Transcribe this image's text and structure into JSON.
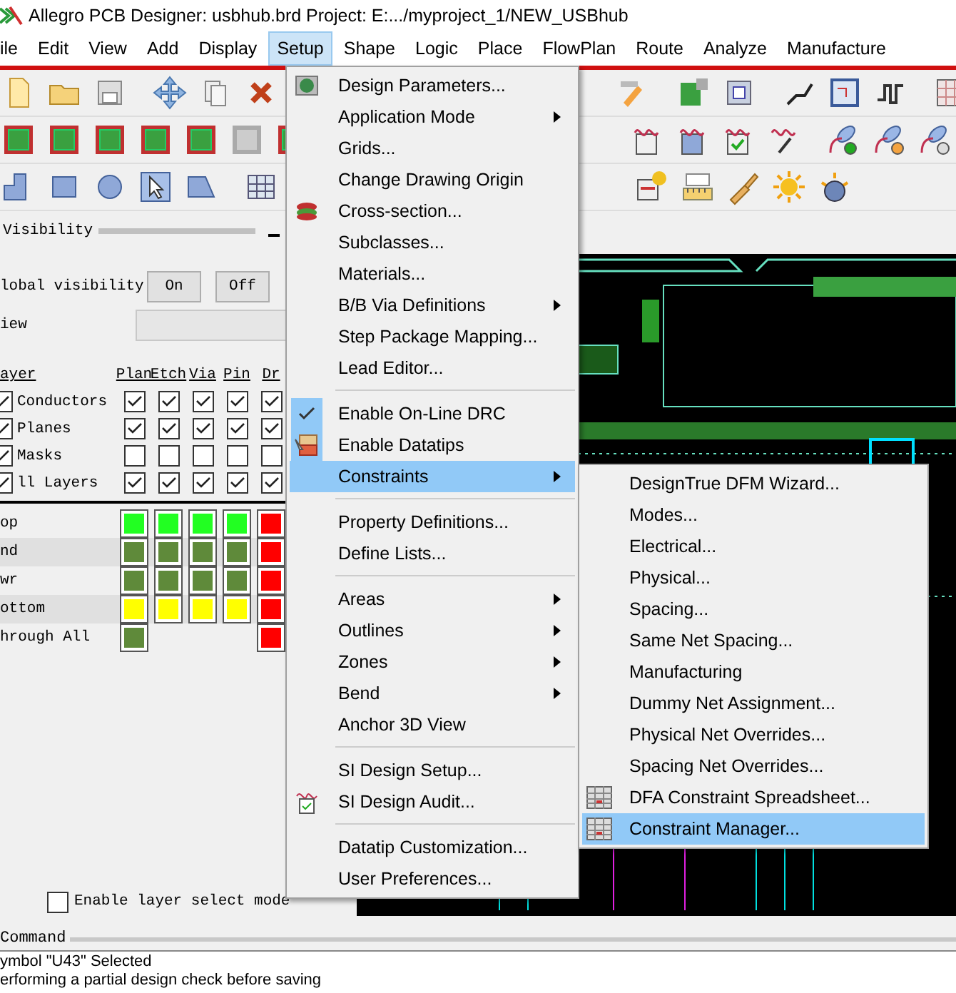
{
  "window": {
    "title": "Allegro PCB Designer: usbhub.brd  Project: E:.../myproject_1/NEW_USBhub"
  },
  "menu_bar": [
    {
      "label": "ile",
      "selected": false
    },
    {
      "label": "Edit",
      "selected": false
    },
    {
      "label": "View",
      "selected": false
    },
    {
      "label": "Add",
      "selected": false
    },
    {
      "label": "Display",
      "selected": false
    },
    {
      "label": "Setup",
      "selected": true
    },
    {
      "label": "Shape",
      "selected": false
    },
    {
      "label": "Logic",
      "selected": false
    },
    {
      "label": "Place",
      "selected": false
    },
    {
      "label": "FlowPlan",
      "selected": false
    },
    {
      "label": "Route",
      "selected": false
    },
    {
      "label": "Analyze",
      "selected": false
    },
    {
      "label": "Manufacture",
      "selected": false
    }
  ],
  "visibility_panel": {
    "title": "Visibility",
    "global_label": "lobal visibility",
    "global_buttons": [
      "On",
      "Off"
    ],
    "view_label": "iew",
    "columns": [
      "ayer",
      "Plan",
      "Etch",
      "Via",
      "Pin",
      "Dr"
    ],
    "class_rows": [
      {
        "name": "Conductors",
        "checked": true,
        "cells": [
          true,
          true,
          true,
          true,
          true
        ]
      },
      {
        "name": "Planes",
        "checked": true,
        "cells": [
          true,
          true,
          true,
          true,
          true
        ]
      },
      {
        "name": "Masks",
        "checked": true,
        "cells": [
          false,
          false,
          false,
          false,
          false
        ]
      },
      {
        "name": "ll Layers",
        "checked": true,
        "cells": [
          true,
          true,
          true,
          true,
          true
        ]
      }
    ],
    "layer_rows": [
      {
        "name": "op",
        "swatches": [
          {
            "color": "#22ff22"
          },
          {
            "color": "#22ff22"
          },
          {
            "color": "#22ff22"
          },
          {
            "color": "#22ff22"
          },
          {
            "color": "#ff0000"
          }
        ]
      },
      {
        "name": "nd",
        "swatches": [
          {
            "color": "#5f8a3a"
          },
          {
            "color": "#5f8a3a"
          },
          {
            "color": "#5f8a3a"
          },
          {
            "color": "#5f8a3a"
          },
          {
            "color": "#ff0000"
          }
        ]
      },
      {
        "name": "wr",
        "swatches": [
          {
            "color": "#5f8a3a"
          },
          {
            "color": "#5f8a3a"
          },
          {
            "color": "#5f8a3a"
          },
          {
            "color": "#5f8a3a"
          },
          {
            "color": "#ff0000"
          }
        ]
      },
      {
        "name": "ottom",
        "swatches": [
          {
            "color": "#ffff00"
          },
          {
            "color": "#ffff00"
          },
          {
            "color": "#ffff00"
          },
          {
            "color": "#ffff00"
          },
          {
            "color": "#ff0000"
          }
        ]
      },
      {
        "name": "hrough All",
        "swatches": [
          {
            "color": "#5f8a3a"
          },
          {
            "kind": "blank"
          },
          {
            "kind": "blank"
          },
          {
            "kind": "blank"
          },
          {
            "color": "#ff0000"
          }
        ]
      }
    ],
    "layer_select_mode": {
      "label": "Enable layer select mode",
      "checked": false
    }
  },
  "setup_menu": [
    {
      "kind": "item",
      "label": "Design Parameters...",
      "submenu": false,
      "selected": false
    },
    {
      "kind": "item",
      "label": "Application Mode",
      "submenu": true,
      "selected": false
    },
    {
      "kind": "item",
      "label": "Grids...",
      "submenu": false,
      "selected": false
    },
    {
      "kind": "item",
      "label": "Change Drawing Origin",
      "submenu": false,
      "selected": false
    },
    {
      "kind": "item",
      "label": "Cross-section...",
      "submenu": false,
      "selected": false
    },
    {
      "kind": "item",
      "label": "Subclasses...",
      "submenu": false,
      "selected": false
    },
    {
      "kind": "item",
      "label": "Materials...",
      "submenu": false,
      "selected": false
    },
    {
      "kind": "item",
      "label": "B/B Via Definitions",
      "submenu": true,
      "selected": false
    },
    {
      "kind": "item",
      "label": "Step Package Mapping...",
      "submenu": false,
      "selected": false
    },
    {
      "kind": "item",
      "label": "Lead Editor...",
      "submenu": false,
      "selected": false
    },
    {
      "kind": "separator"
    },
    {
      "kind": "toggle",
      "label": "Enable On-Line DRC",
      "checked": true,
      "submenu": false,
      "selected": false
    },
    {
      "kind": "toggle",
      "label": "Enable Datatips",
      "checked": true,
      "submenu": false,
      "selected": false
    },
    {
      "kind": "item",
      "label": "Constraints",
      "submenu": true,
      "selected": true
    },
    {
      "kind": "separator"
    },
    {
      "kind": "item",
      "label": "Property Definitions...",
      "submenu": false,
      "selected": false
    },
    {
      "kind": "item",
      "label": "Define Lists...",
      "submenu": false,
      "selected": false
    },
    {
      "kind": "separator"
    },
    {
      "kind": "item",
      "label": "Areas",
      "submenu": true,
      "selected": false
    },
    {
      "kind": "item",
      "label": "Outlines",
      "submenu": true,
      "selected": false
    },
    {
      "kind": "item",
      "label": "Zones",
      "submenu": true,
      "selected": false
    },
    {
      "kind": "item",
      "label": "Bend",
      "submenu": true,
      "selected": false
    },
    {
      "kind": "item",
      "label": "Anchor 3D View",
      "submenu": false,
      "selected": false
    },
    {
      "kind": "separator"
    },
    {
      "kind": "item",
      "label": "SI Design Setup...",
      "submenu": false,
      "selected": false
    },
    {
      "kind": "item",
      "label": "SI Design Audit...",
      "submenu": false,
      "selected": false
    },
    {
      "kind": "separator"
    },
    {
      "kind": "item",
      "label": "Datatip Customization...",
      "submenu": false,
      "selected": false
    },
    {
      "kind": "item",
      "label": "User Preferences...",
      "submenu": false,
      "selected": false
    }
  ],
  "constraints_submenu": [
    {
      "label": "DesignTrue DFM Wizard...",
      "selected": false
    },
    {
      "label": "Modes...",
      "selected": false
    },
    {
      "label": "Electrical...",
      "selected": false
    },
    {
      "label": "Physical...",
      "selected": false
    },
    {
      "label": "Spacing...",
      "selected": false
    },
    {
      "label": "Same Net Spacing...",
      "selected": false
    },
    {
      "label": "Manufacturing",
      "selected": false
    },
    {
      "label": "Dummy Net Assignment...",
      "selected": false
    },
    {
      "label": "Physical Net Overrides...",
      "selected": false
    },
    {
      "label": "Spacing Net Overrides...",
      "selected": false
    },
    {
      "label": "DFA Constraint Spreadsheet...",
      "selected": false
    },
    {
      "label": "Constraint Manager...",
      "selected": true
    }
  ],
  "command": {
    "title": "Command",
    "lines": [
      "ymbol \"U43\" Selected",
      "erforming a partial design check before saving"
    ]
  }
}
